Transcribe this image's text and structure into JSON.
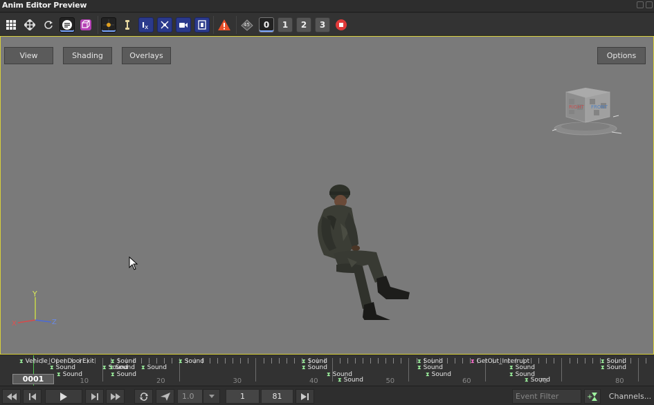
{
  "window": {
    "title": "Anim Editor Preview"
  },
  "toolbar": {
    "buttons": [
      {
        "name": "grid-icon"
      },
      {
        "name": "move-icon"
      },
      {
        "name": "rotate-icon"
      },
      {
        "name": "lines-icon"
      },
      {
        "name": "cube-icon"
      },
      {
        "name": "pivot-icon"
      },
      {
        "name": "bone-icon"
      },
      {
        "name": "axis-x-icon"
      },
      {
        "name": "axis-xy-icon"
      },
      {
        "name": "camera-icon"
      },
      {
        "name": "film-icon"
      },
      {
        "name": "warning-icon"
      },
      {
        "name": "angle-45-icon"
      }
    ],
    "levels": [
      "0",
      "1",
      "2",
      "3"
    ],
    "record_icon": "record-icon",
    "angle_label": "45"
  },
  "viewport": {
    "view_label": "View",
    "shading_label": "Shading",
    "overlays_label": "Overlays",
    "options_label": "Options",
    "gizmo": {
      "y": "Y",
      "x": "X",
      "z": "Z"
    },
    "cube_labels": {
      "right": "RIGHT",
      "front": "FRONT"
    }
  },
  "timeline": {
    "current_frame": "0001",
    "labels": [
      "10",
      "20",
      "30",
      "40",
      "50",
      "60",
      "70",
      "80"
    ],
    "events": [
      {
        "text": "Vehicle_OpenDoorExit",
        "type": "green"
      },
      {
        "text": "Sound",
        "type": "green"
      },
      {
        "text": "Sound",
        "type": "green"
      },
      {
        "text": "Sound",
        "type": "green"
      },
      {
        "text": "Sound",
        "type": "green"
      },
      {
        "text": "Sound",
        "type": "green"
      },
      {
        "text": "Sound",
        "type": "green"
      },
      {
        "text": "Sound",
        "type": "green"
      },
      {
        "text": "Sound",
        "type": "green"
      },
      {
        "text": "Sound",
        "type": "green"
      },
      {
        "text": "Sound",
        "type": "green"
      },
      {
        "text": "Sound",
        "type": "green"
      },
      {
        "text": "Sound",
        "type": "green"
      },
      {
        "text": "Sound",
        "type": "green"
      },
      {
        "text": "Sound",
        "type": "green"
      },
      {
        "text": "Sound",
        "type": "green"
      },
      {
        "text": "GetOut_Interrupt",
        "type": "pink"
      },
      {
        "text": "Sound",
        "type": "green"
      },
      {
        "text": "Sound",
        "type": "green"
      },
      {
        "text": "Sound",
        "type": "green"
      },
      {
        "text": "Sound",
        "type": "green"
      },
      {
        "text": "Sound",
        "type": "green"
      }
    ]
  },
  "transport": {
    "speed": "1.0",
    "start_frame": "1",
    "end_frame": "81",
    "event_filter_placeholder": "Event Filter",
    "channels_label": "Channels..."
  },
  "colors": {
    "viewport_bg": "#7a7a7a",
    "viewport_border": "#d9d13a",
    "event_marker": "#9ff5a0",
    "playhead": "#4ec94e"
  }
}
